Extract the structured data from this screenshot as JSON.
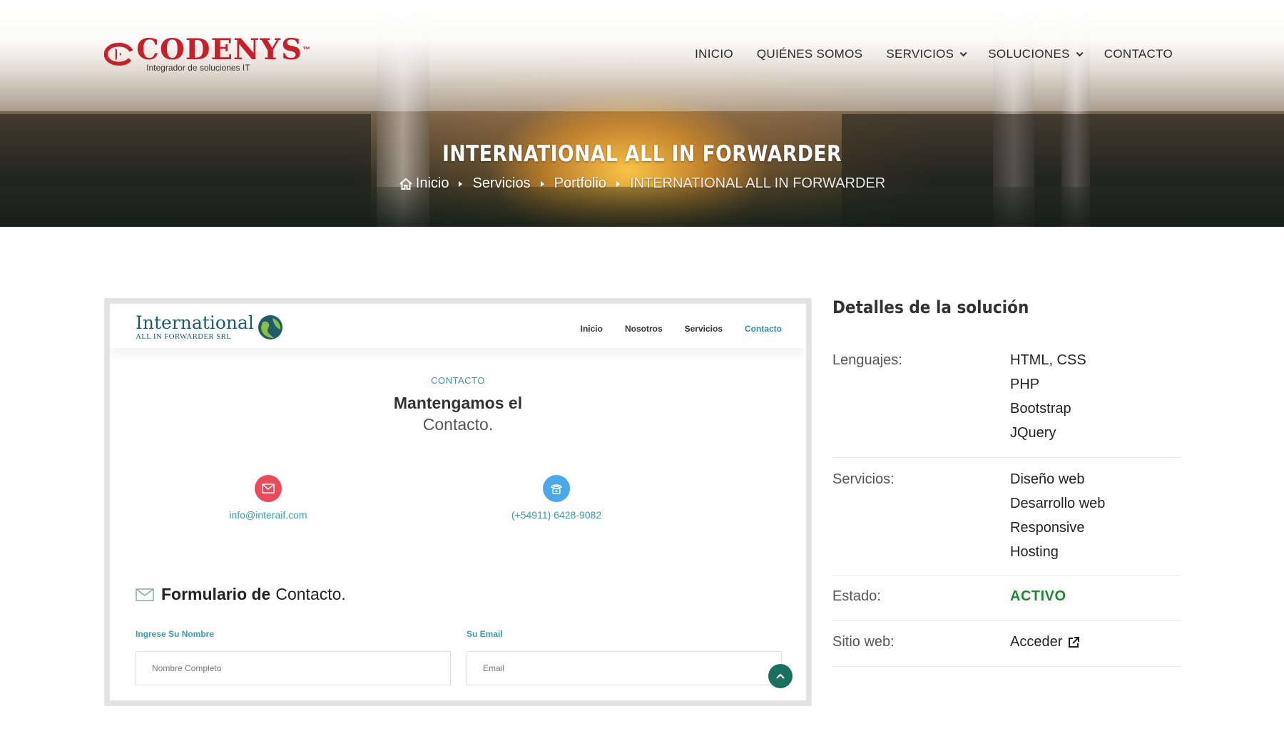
{
  "brand": {
    "name": "CODENYS",
    "trademark": "™",
    "tagline": "Integrador de soluciones IT",
    "color": "#c8202a"
  },
  "nav": {
    "items": [
      {
        "label": "INICIO"
      },
      {
        "label": "QUIÉNES SOMOS"
      },
      {
        "label": "SERVICIOS",
        "dropdown": true
      },
      {
        "label": "SOLUCIONES",
        "dropdown": true
      },
      {
        "label": "CONTACTO"
      }
    ]
  },
  "hero": {
    "title": "INTERNATIONAL ALL IN FORWARDER",
    "breadcrumb": [
      "Inicio",
      "Servicios",
      "Portfolio",
      "INTERNATIONAL ALL IN FORWARDER"
    ]
  },
  "preview": {
    "logo_name": "International",
    "logo_sub": "ALL IN FORWARDER SRL",
    "nav": [
      "Inicio",
      "Nosotros",
      "Servicios",
      "Contacto"
    ],
    "active_nav": "Contacto",
    "kicker": "CONTACTO",
    "heading_bold": "Mantengamos el",
    "heading_light": "Contacto.",
    "email": "info@interaif.com",
    "phone": "(+54911) 6428-9082",
    "form_title_bold": "Formulario de",
    "form_title_light": "Contacto.",
    "name_label": "Ingrese Su Nombre",
    "name_placeholder": "Nombre Completo",
    "email_label": "Su Email",
    "email_placeholder": "Email",
    "accent": "#3a9aae",
    "email_icon_color": "#ea4a5a",
    "phone_icon_color": "#4aa8ea"
  },
  "details": {
    "title": "Detalles de la solución",
    "languages_label": "Lenguajes:",
    "languages": [
      "HTML, CSS",
      "PHP",
      "Bootstrap",
      "JQuery"
    ],
    "services_label": "Servicios:",
    "services": [
      "Diseño web",
      "Desarrollo web",
      "Responsive",
      "Hosting"
    ],
    "status_label": "Estado:",
    "status": "ACTIVO",
    "status_color": "#1c8a2c",
    "site_label": "Sitio web:",
    "site_link": "Acceder"
  }
}
